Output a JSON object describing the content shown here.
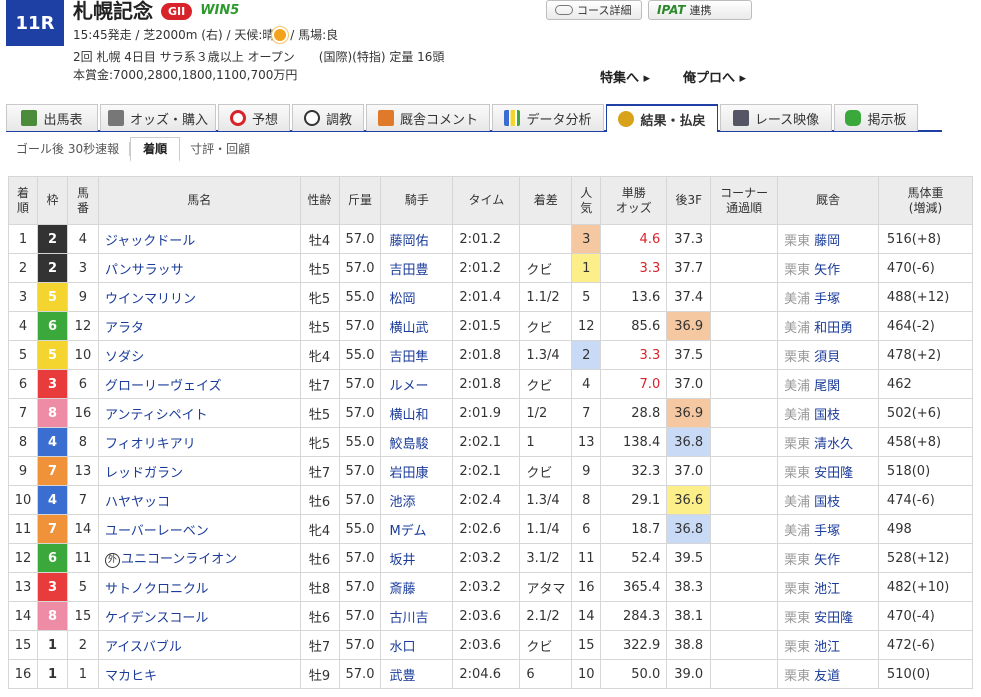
{
  "race": {
    "number": "11R",
    "title": "札幌記念",
    "grade": "GII",
    "win5": "WIN5",
    "line1_pre": "15:45発走 / 芝2000m (右) / 天候:晴",
    "line1_post": " / 馬場:良",
    "line2": "2回 札幌 4日目 サラ系３歳以上 オープン　　(国際)(特指) 定量 16頭",
    "line3": "本賞金:7000,2800,1800,1100,700万円"
  },
  "buttons": {
    "course": "コース詳細",
    "ipat_logo": "IPAT",
    "ipat": "連携"
  },
  "links": {
    "feature": "特集へ ▸",
    "ore": "俺プロへ ▸"
  },
  "tabs": [
    {
      "label": "出馬表",
      "icon": "table-icon",
      "color": "#4a8c3a"
    },
    {
      "label": "オッズ・購入",
      "icon": "odds-icon",
      "color": "#666"
    },
    {
      "label": "予想",
      "icon": "target-icon",
      "color": "#d8232a"
    },
    {
      "label": "調教",
      "icon": "stopwatch-icon",
      "color": "#333"
    },
    {
      "label": "厩舎コメント",
      "icon": "stable-icon",
      "color": "#e07a2a"
    },
    {
      "label": "データ分析",
      "icon": "bar-chart-icon",
      "color": "#3a6fd1"
    },
    {
      "label": "結果・払戻",
      "icon": "coins-icon",
      "color": "#d9a21b"
    },
    {
      "label": "レース映像",
      "icon": "video-icon",
      "color": "#555"
    },
    {
      "label": "掲示板",
      "icon": "chat-icon",
      "color": "#3aa83a"
    }
  ],
  "subtabs": [
    "ゴール後 30秒速報",
    "着順",
    "寸評・回顧"
  ],
  "table": {
    "headers": {
      "rank": "着\n順",
      "waku": "枠",
      "num": "馬\n番",
      "name": "馬名",
      "sexage": "性齢",
      "kinryo": "斤量",
      "jockey": "騎手",
      "time": "タイム",
      "margin": "着差",
      "pop": "人\n気",
      "odds": "単勝\nオッズ",
      "f3": "後3F",
      "corner": "コーナー\n通過順",
      "trainer": "厩舎",
      "bw": "馬体重\n(増減)"
    },
    "rows": [
      {
        "rank": "1",
        "waku": "2",
        "num": "4",
        "name": "ジャックドール",
        "gai": false,
        "sexage": "牡4",
        "kinryo": "57.0",
        "jockey": "藤岡佑",
        "time": "2:01.2",
        "margin": "",
        "pop": "3",
        "popc": "pop3",
        "odds": "4.6",
        "oddsRed": true,
        "f3": "37.3",
        "f3c": "",
        "area": "栗東",
        "trainer": "藤岡",
        "bw": "516(+8)"
      },
      {
        "rank": "2",
        "waku": "2",
        "num": "3",
        "name": "パンサラッサ",
        "gai": false,
        "sexage": "牡5",
        "kinryo": "57.0",
        "jockey": "吉田豊",
        "time": "2:01.2",
        "margin": "クビ",
        "pop": "1",
        "popc": "pop1",
        "odds": "3.3",
        "oddsRed": true,
        "f3": "37.7",
        "f3c": "",
        "area": "栗東",
        "trainer": "矢作",
        "bw": "470(-6)"
      },
      {
        "rank": "3",
        "waku": "5",
        "num": "9",
        "name": "ウインマリリン",
        "gai": false,
        "sexage": "牝5",
        "kinryo": "55.0",
        "jockey": "松岡",
        "time": "2:01.4",
        "margin": "1.1/2",
        "pop": "5",
        "popc": "",
        "odds": "13.6",
        "oddsRed": false,
        "f3": "37.4",
        "f3c": "",
        "area": "美浦",
        "trainer": "手塚",
        "bw": "488(+12)"
      },
      {
        "rank": "4",
        "waku": "6",
        "num": "12",
        "name": "アラタ",
        "gai": false,
        "sexage": "牡5",
        "kinryo": "57.0",
        "jockey": "横山武",
        "time": "2:01.5",
        "margin": "クビ",
        "pop": "12",
        "popc": "",
        "odds": "85.6",
        "oddsRed": false,
        "f3": "36.9",
        "f3c": "f3",
        "area": "美浦",
        "trainer": "和田勇",
        "bw": "464(-2)"
      },
      {
        "rank": "5",
        "waku": "5",
        "num": "10",
        "name": "ソダシ",
        "gai": false,
        "sexage": "牝4",
        "kinryo": "55.0",
        "jockey": "吉田隼",
        "time": "2:01.8",
        "margin": "1.3/4",
        "pop": "2",
        "popc": "pop2",
        "odds": "3.3",
        "oddsRed": true,
        "f3": "37.5",
        "f3c": "",
        "area": "栗東",
        "trainer": "須貝",
        "bw": "478(+2)"
      },
      {
        "rank": "6",
        "waku": "3",
        "num": "6",
        "name": "グローリーヴェイズ",
        "gai": false,
        "sexage": "牡7",
        "kinryo": "57.0",
        "jockey": "ルメー",
        "time": "2:01.8",
        "margin": "クビ",
        "pop": "4",
        "popc": "",
        "odds": "7.0",
        "oddsRed": true,
        "f3": "37.0",
        "f3c": "",
        "area": "美浦",
        "trainer": "尾関",
        "bw": "462"
      },
      {
        "rank": "7",
        "waku": "8",
        "num": "16",
        "name": "アンティシペイト",
        "gai": false,
        "sexage": "牡5",
        "kinryo": "57.0",
        "jockey": "横山和",
        "time": "2:01.9",
        "margin": "1/2",
        "pop": "7",
        "popc": "",
        "odds": "28.8",
        "oddsRed": false,
        "f3": "36.9",
        "f3c": "f3",
        "area": "美浦",
        "trainer": "国枝",
        "bw": "502(+6)"
      },
      {
        "rank": "8",
        "waku": "4",
        "num": "8",
        "name": "フィオリキアリ",
        "gai": false,
        "sexage": "牝5",
        "kinryo": "55.0",
        "jockey": "鮫島駿",
        "time": "2:02.1",
        "margin": "1",
        "pop": "13",
        "popc": "",
        "odds": "138.4",
        "oddsRed": false,
        "f3": "36.8",
        "f3c": "f2",
        "area": "栗東",
        "trainer": "清水久",
        "bw": "458(+8)"
      },
      {
        "rank": "9",
        "waku": "7",
        "num": "13",
        "name": "レッドガラン",
        "gai": false,
        "sexage": "牡7",
        "kinryo": "57.0",
        "jockey": "岩田康",
        "time": "2:02.1",
        "margin": "クビ",
        "pop": "9",
        "popc": "",
        "odds": "32.3",
        "oddsRed": false,
        "f3": "37.0",
        "f3c": "",
        "area": "栗東",
        "trainer": "安田隆",
        "bw": "518(0)"
      },
      {
        "rank": "10",
        "waku": "4",
        "num": "7",
        "name": "ハヤヤッコ",
        "gai": false,
        "sexage": "牡6",
        "kinryo": "57.0",
        "jockey": "池添",
        "time": "2:02.4",
        "margin": "1.3/4",
        "pop": "8",
        "popc": "",
        "odds": "29.1",
        "oddsRed": false,
        "f3": "36.6",
        "f3c": "f1",
        "area": "美浦",
        "trainer": "国枝",
        "bw": "474(-6)"
      },
      {
        "rank": "11",
        "waku": "7",
        "num": "14",
        "name": "ユーバーレーベン",
        "gai": false,
        "sexage": "牝4",
        "kinryo": "55.0",
        "jockey": "Mデム",
        "time": "2:02.6",
        "margin": "1.1/4",
        "pop": "6",
        "popc": "",
        "odds": "18.7",
        "oddsRed": false,
        "f3": "36.8",
        "f3c": "f2",
        "area": "美浦",
        "trainer": "手塚",
        "bw": "498"
      },
      {
        "rank": "12",
        "waku": "6",
        "num": "11",
        "name": "ユニコーンライオン",
        "gai": true,
        "sexage": "牡6",
        "kinryo": "57.0",
        "jockey": "坂井",
        "time": "2:03.2",
        "margin": "3.1/2",
        "pop": "11",
        "popc": "",
        "odds": "52.4",
        "oddsRed": false,
        "f3": "39.5",
        "f3c": "",
        "area": "栗東",
        "trainer": "矢作",
        "bw": "528(+12)"
      },
      {
        "rank": "13",
        "waku": "3",
        "num": "5",
        "name": "サトノクロニクル",
        "gai": false,
        "sexage": "牡8",
        "kinryo": "57.0",
        "jockey": "斎藤",
        "time": "2:03.2",
        "margin": "アタマ",
        "pop": "16",
        "popc": "",
        "odds": "365.4",
        "oddsRed": false,
        "f3": "38.3",
        "f3c": "",
        "area": "栗東",
        "trainer": "池江",
        "bw": "482(+10)"
      },
      {
        "rank": "14",
        "waku": "8",
        "num": "15",
        "name": "ケイデンスコール",
        "gai": false,
        "sexage": "牡6",
        "kinryo": "57.0",
        "jockey": "古川吉",
        "time": "2:03.6",
        "margin": "2.1/2",
        "pop": "14",
        "popc": "",
        "odds": "284.3",
        "oddsRed": false,
        "f3": "38.1",
        "f3c": "",
        "area": "栗東",
        "trainer": "安田隆",
        "bw": "470(-4)"
      },
      {
        "rank": "15",
        "waku": "1",
        "num": "2",
        "name": "アイスバブル",
        "gai": false,
        "sexage": "牡7",
        "kinryo": "57.0",
        "jockey": "水口",
        "time": "2:03.6",
        "margin": "クビ",
        "pop": "15",
        "popc": "",
        "odds": "322.9",
        "oddsRed": false,
        "f3": "38.8",
        "f3c": "",
        "area": "栗東",
        "trainer": "池江",
        "bw": "472(-6)"
      },
      {
        "rank": "16",
        "waku": "1",
        "num": "1",
        "name": "マカヒキ",
        "gai": false,
        "sexage": "牡9",
        "kinryo": "57.0",
        "jockey": "武豊",
        "time": "2:04.6",
        "margin": "6",
        "pop": "10",
        "popc": "",
        "odds": "50.0",
        "oddsRed": false,
        "f3": "39.0",
        "f3c": "",
        "area": "栗東",
        "trainer": "友道",
        "bw": "510(0)"
      }
    ]
  }
}
